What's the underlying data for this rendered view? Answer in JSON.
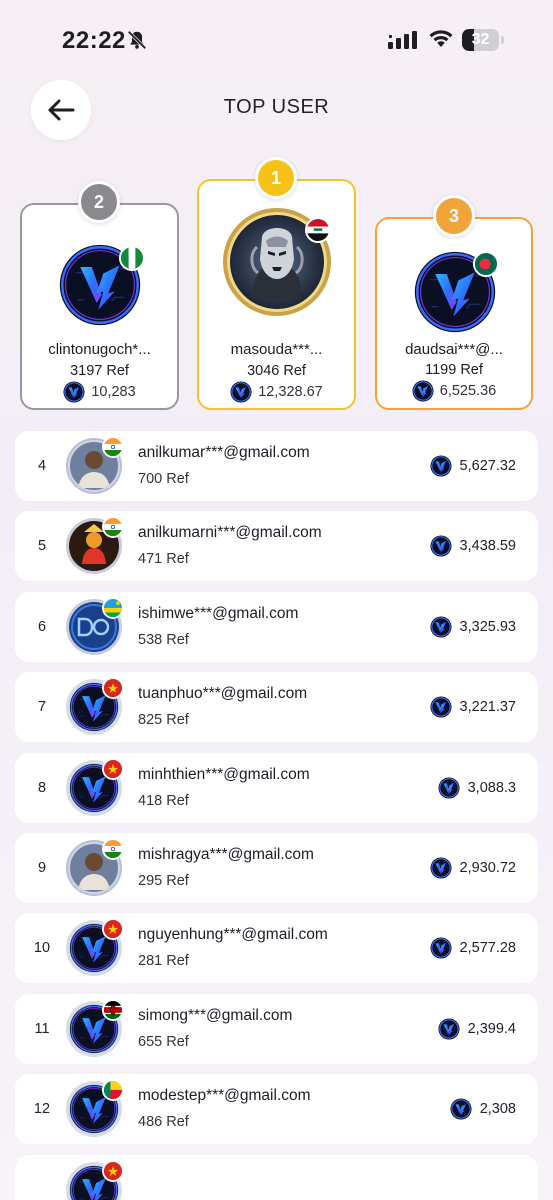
{
  "status_bar": {
    "time": "22:22",
    "battery": "32",
    "battery_level": 0.32
  },
  "header": {
    "title": "TOP USER"
  },
  "podium": [
    {
      "rank": "1",
      "name": "masouda***...",
      "ref": "3046 Ref",
      "amount": "12,328.67",
      "flag": "iraq-flag",
      "avatar": "warrior-avatar"
    },
    {
      "rank": "2",
      "name": "clintonugoch*...",
      "ref": "3197 Ref",
      "amount": "10,283",
      "flag": "nigeria-flag",
      "avatar": "brand-logo-avatar"
    },
    {
      "rank": "3",
      "name": "daudsai***@...",
      "ref": "1199 Ref",
      "amount": "6,525.36",
      "flag": "bangladesh-flag",
      "avatar": "brand-logo-avatar"
    }
  ],
  "list": [
    {
      "rank": "4",
      "email": "anilkumar***@gmail.com",
      "ref": "700 Ref",
      "amount": "5,627.32",
      "flag": "india-flag",
      "avatar": "photo-avatar"
    },
    {
      "rank": "5",
      "email": "anilkumarni***@gmail.com",
      "ref": "471 Ref",
      "amount": "3,438.59",
      "flag": "india-flag",
      "avatar": "deity-avatar"
    },
    {
      "rank": "6",
      "email": "ishimwe***@gmail.com",
      "ref": "538 Ref",
      "amount": "3,325.93",
      "flag": "rwanda-flag",
      "avatar": "letters-avatar"
    },
    {
      "rank": "7",
      "email": "tuanphuo***@gmail.com",
      "ref": "825 Ref",
      "amount": "3,221.37",
      "flag": "vietnam-flag",
      "avatar": "brand-logo-avatar"
    },
    {
      "rank": "8",
      "email": "minhthien***@gmail.com",
      "ref": "418 Ref",
      "amount": "3,088.3",
      "flag": "vietnam-flag",
      "avatar": "brand-logo-avatar"
    },
    {
      "rank": "9",
      "email": "mishragya***@gmail.com",
      "ref": "295 Ref",
      "amount": "2,930.72",
      "flag": "india-flag",
      "avatar": "photo-avatar"
    },
    {
      "rank": "10",
      "email": "nguyenhung***@gmail.com",
      "ref": "281 Ref",
      "amount": "2,577.28",
      "flag": "vietnam-flag",
      "avatar": "brand-logo-avatar"
    },
    {
      "rank": "11",
      "email": "simong***@gmail.com",
      "ref": "655 Ref",
      "amount": "2,399.4",
      "flag": "kenya-flag",
      "avatar": "brand-logo-avatar"
    },
    {
      "rank": "12",
      "email": "modestep***@gmail.com",
      "ref": "486 Ref",
      "amount": "2,308",
      "flag": "benin-flag",
      "avatar": "brand-logo-avatar"
    },
    {
      "rank": "",
      "email": "",
      "ref": "",
      "amount": "",
      "flag": "vietnam-flag",
      "avatar": "brand-logo-avatar"
    }
  ],
  "colors": {
    "gold": "#f5c218",
    "silver": "#8a8a8e",
    "bronze": "#f0a43a",
    "brand_blue": "#1b4fd8",
    "brand_purple": "#7a2bd6"
  }
}
